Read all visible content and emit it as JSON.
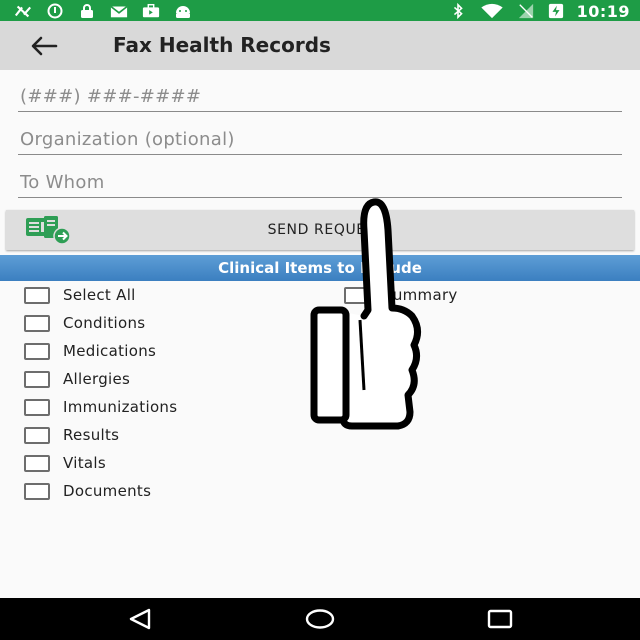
{
  "status_bar": {
    "time": "10:19",
    "left_icons": [
      "no-signal-icon",
      "info-icon",
      "lock-icon",
      "mail-icon",
      "briefcase-icon",
      "android-icon"
    ],
    "right_icons": [
      "bluetooth-icon",
      "wifi-icon",
      "signal-icon",
      "battery-charging-icon"
    ],
    "color": "#1e9c46"
  },
  "app_bar": {
    "title": "Fax Health Records"
  },
  "form": {
    "phone_placeholder": "(###) ###-####",
    "organization_placeholder": "Organization (optional)",
    "to_whom_placeholder": "To Whom"
  },
  "send_button": {
    "label": "SEND REQUEST"
  },
  "section": {
    "title": "Clinical Items to Include",
    "color": "#4a8cc9"
  },
  "checkboxes": {
    "select_all": "Select All",
    "summary": "Summary",
    "conditions": "Conditions",
    "medications": "Medications",
    "allergies": "Allergies",
    "immunizations": "Immunizations",
    "results": "Results",
    "vitals": "Vitals",
    "documents": "Documents"
  },
  "nav_bar": {
    "icons": [
      "back-triangle-icon",
      "home-circle-icon",
      "recents-square-icon"
    ]
  }
}
